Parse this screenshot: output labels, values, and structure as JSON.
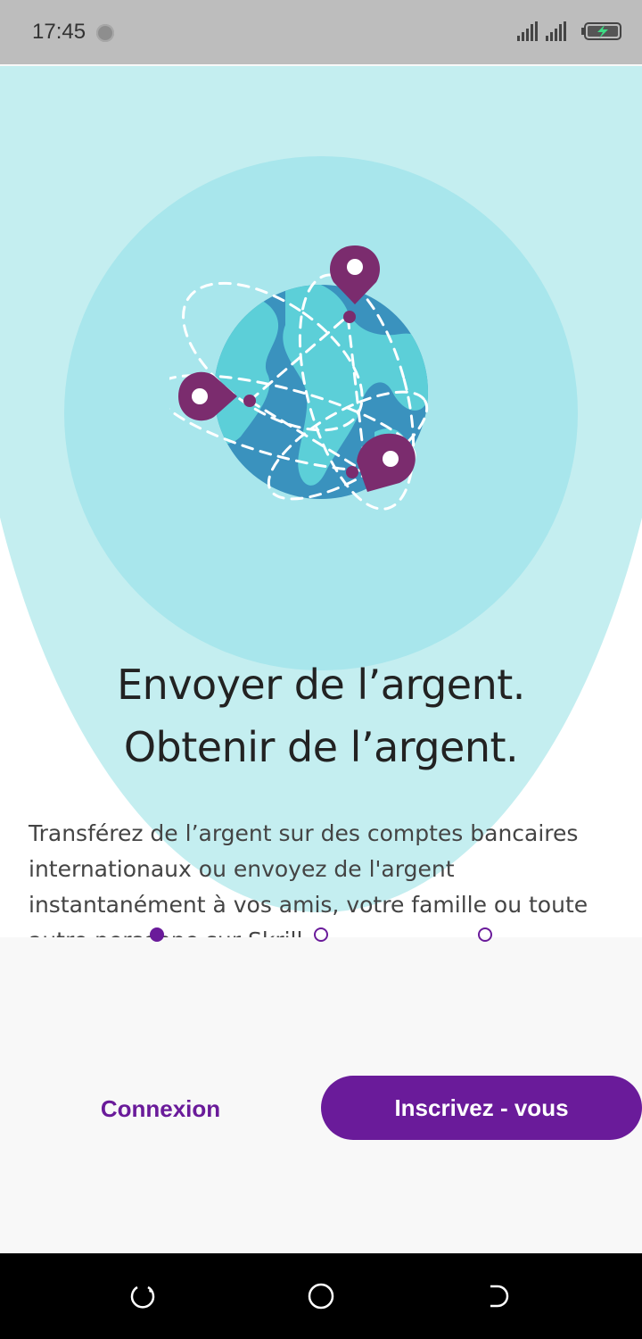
{
  "status_bar": {
    "time": "17:45",
    "icons": [
      "record-dot-icon",
      "signal-icon",
      "signal-icon",
      "battery-charging-icon"
    ]
  },
  "hero": {
    "illustration": "globe-with-location-pins-icon",
    "title_line1": "Envoyer de l’argent.",
    "title_line2": "Obtenir de l’argent.",
    "description": "Transférez de l’argent sur des comptes bancaires internationaux ou envoyez de l'argent instantanément à vos amis, votre famille ou toute autre personne sur Skrill."
  },
  "pager": {
    "count": 3,
    "active_index": 0
  },
  "actions": {
    "login_label": "Connexion",
    "signup_label": "Inscrivez - vous"
  },
  "nav_bar": {
    "icons": [
      "recent-apps-icon",
      "home-icon",
      "back-icon"
    ]
  },
  "colors": {
    "accent": "#6a1b9a",
    "pin": "#7b2c6e",
    "globe_ocean": "#3a92be",
    "globe_land": "#5ccfd8",
    "hero_bg": "#c4eef0",
    "hero_circle": "#a8e6ec"
  }
}
